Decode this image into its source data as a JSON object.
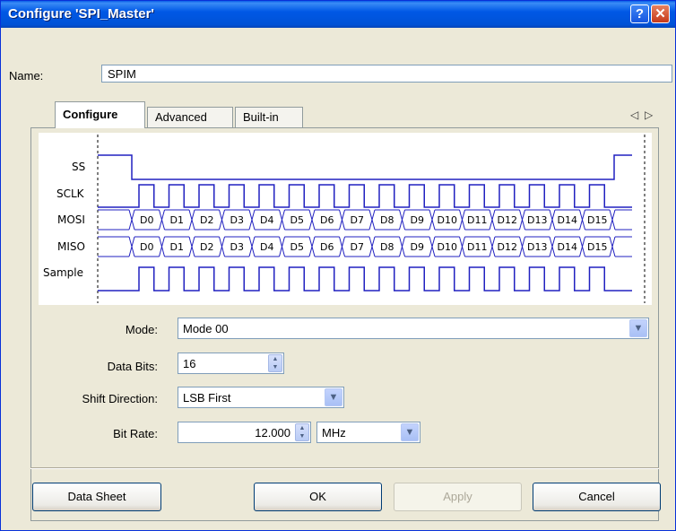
{
  "window": {
    "title": "Configure 'SPI_Master'",
    "help_label": "?",
    "close_label": "✕"
  },
  "name": {
    "label": "Name:",
    "value": "SPIM"
  },
  "tabs": [
    {
      "label": "Configure",
      "active": true
    },
    {
      "label": "Advanced",
      "active": false
    },
    {
      "label": "Built-in",
      "active": false
    }
  ],
  "tab_scroll": {
    "left": "◁",
    "right": "▷"
  },
  "diagram": {
    "signals": [
      "SS",
      "SCLK",
      "MOSI",
      "MISO",
      "Sample"
    ],
    "bits": [
      "D0",
      "D1",
      "D2",
      "D3",
      "D4",
      "D5",
      "D6",
      "D7",
      "D8",
      "D9",
      "D10",
      "D11",
      "D12",
      "D13",
      "D14",
      "D15"
    ],
    "line_color": "#2020c0"
  },
  "fields": {
    "mode": {
      "label": "Mode:",
      "value": "Mode 00"
    },
    "data_bits": {
      "label": "Data Bits:",
      "value": "16"
    },
    "shift_direction": {
      "label": "Shift Direction:",
      "value": "LSB First"
    },
    "bit_rate": {
      "label": "Bit Rate:",
      "value": "12.000",
      "unit": "MHz"
    }
  },
  "buttons": {
    "data_sheet": "Data Sheet",
    "ok": "OK",
    "apply": "Apply",
    "cancel": "Cancel"
  }
}
